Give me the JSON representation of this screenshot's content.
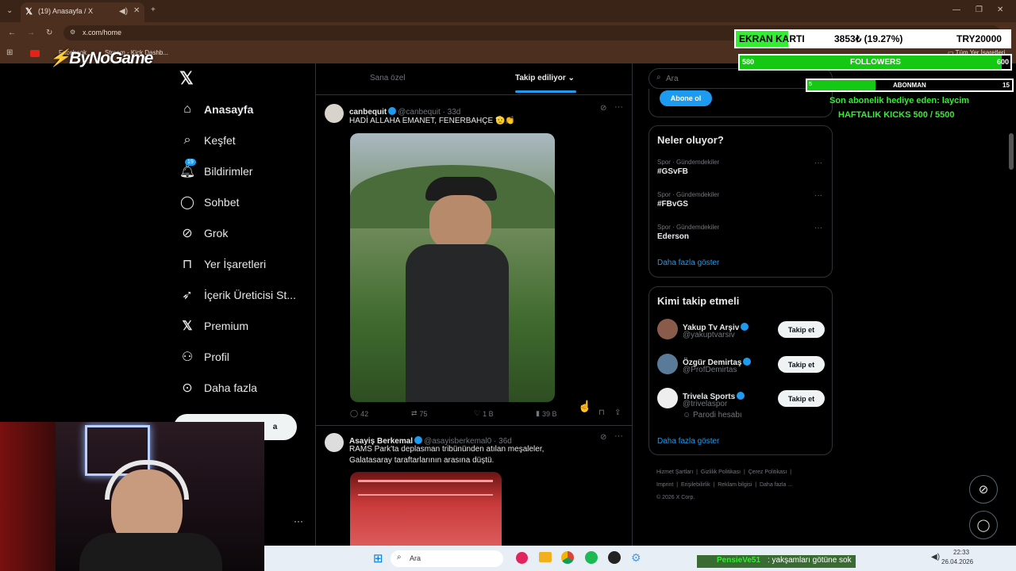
{
  "browser": {
    "tab_title": "(19) Anasayfa / X",
    "url": "x.com/home",
    "bookmarks": [
      "Facebook",
      "Stream - Kick Dashb..."
    ],
    "bookmarks_folder": "Tüm Yer İşaretleri"
  },
  "nav": {
    "items": [
      {
        "label": "Anasayfa",
        "icon": "home-icon"
      },
      {
        "label": "Keşfet",
        "icon": "search-icon"
      },
      {
        "label": "Bildirimler",
        "icon": "bell-icon",
        "badge": "19"
      },
      {
        "label": "Sohbet",
        "icon": "chat-icon"
      },
      {
        "label": "Grok",
        "icon": "grok-icon"
      },
      {
        "label": "Yer İşaretleri",
        "icon": "bookmark-icon"
      },
      {
        "label": "İçerik Üreticisi St...",
        "icon": "rocket-icon"
      },
      {
        "label": "Premium",
        "icon": "x-icon"
      },
      {
        "label": "Profil",
        "icon": "person-icon"
      },
      {
        "label": "Daha fazla",
        "icon": "more-circle-icon"
      }
    ],
    "post_button": "a"
  },
  "feed": {
    "tabs": [
      "Sana özel",
      "Takip ediliyor"
    ],
    "tweets": [
      {
        "name": "canbequit",
        "handle": "@canbequit · 33d",
        "text": "HADİ ALLAHA EMANET, FENERBAHÇE 🫡👏",
        "replies": "42",
        "retweets": "75",
        "likes": "1 B",
        "views": "39 B"
      },
      {
        "name": "Asayiş Berkemal",
        "handle": "@asayisberkemal0 · 36d",
        "text": "RAMS Park'ta deplasman tribününden atılan meşaleler, Galatasaray taraftarlarının arasına düştü."
      }
    ]
  },
  "right": {
    "search_placeholder": "Ara",
    "subscribe_button": "Abone ol",
    "trends_title": "Neler oluyor?",
    "trends": [
      {
        "context": "Spor · Gündemdekiler",
        "tag": "#GSvFB"
      },
      {
        "context": "Spor · Gündemdekiler",
        "tag": "#FBvGS"
      },
      {
        "context": "Spor · Gündemdekiler",
        "tag": "Ederson"
      }
    ],
    "show_more": "Daha fazla göster",
    "who_title": "Kimi takip etmeli",
    "who": [
      {
        "name": "Yakup Tv Arşiv",
        "handle": "@yakuptvarsiv",
        "button": "Takip et"
      },
      {
        "name": "Özgür Demirtaş",
        "handle": "@ProfDemirtas",
        "button": "Takip et"
      },
      {
        "name": "Trivela Sports",
        "handle": "@trivelaspor",
        "extra": "Parodi hesabı",
        "button": "Takip et"
      }
    ],
    "who_more": "Daha fazla göster",
    "footer": [
      "Hizmet Şartları",
      "Gizlilik Politikası",
      "Çerez Politikası",
      "Imprint",
      "Erişilebilirlik",
      "Reklam bilgisi",
      "Daha fazla ...",
      "© 2026 X Corp."
    ]
  },
  "overlay": {
    "logo": "ByNoGame",
    "goal_label": "EKRAN KARTI",
    "goal_value": "3853₺ (19.27%)",
    "goal_target": "TRY20000",
    "goal_fraction": 0.1927,
    "followers_label": "FOLLOWERS",
    "followers_current": "580",
    "followers_target": "600",
    "followers_fraction": 0.967,
    "sub_label": "ABONMAN",
    "sub_current": "5",
    "sub_target": "15",
    "sub_fraction": 0.333,
    "gift_text": "Son abonelik hediye eden: laycim",
    "kicks_text": "HAFTALIK KICKS 500 / 5500",
    "chat_user": "PensieVe51",
    "chat_msg": ": yakşamları götüne sok"
  },
  "taskbar": {
    "search": "Ara",
    "time": "22:33",
    "date": "26.04.2026"
  }
}
